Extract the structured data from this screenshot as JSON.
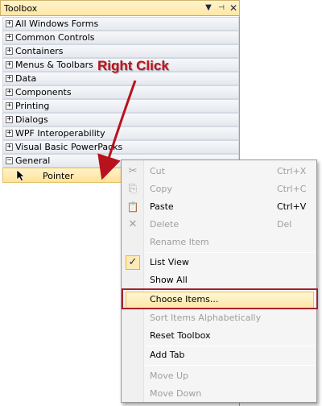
{
  "toolbox": {
    "title": "Toolbox",
    "dropdown_glyph": "▼",
    "pin_glyph": "⊣",
    "close_glyph": "✕",
    "tabs": [
      {
        "expander": "+",
        "label": "All Windows Forms"
      },
      {
        "expander": "+",
        "label": "Common Controls"
      },
      {
        "expander": "+",
        "label": "Containers"
      },
      {
        "expander": "+",
        "label": "Menus & Toolbars"
      },
      {
        "expander": "+",
        "label": "Data"
      },
      {
        "expander": "+",
        "label": "Components"
      },
      {
        "expander": "+",
        "label": "Printing"
      },
      {
        "expander": "+",
        "label": "Dialogs"
      },
      {
        "expander": "+",
        "label": "WPF Interoperability"
      },
      {
        "expander": "+",
        "label": "Visual Basic PowerPacks"
      },
      {
        "expander": "−",
        "label": "General"
      }
    ],
    "pointer_item": "Pointer"
  },
  "annotation": {
    "label": "Right Click",
    "color": "#c0101a"
  },
  "context_menu": {
    "items": [
      {
        "icon": "✂",
        "label": "Cut",
        "shortcut": "Ctrl+X"
      },
      {
        "icon": "⎘",
        "label": "Copy",
        "shortcut": "Ctrl+C"
      },
      {
        "icon": "📋",
        "label": "Paste",
        "shortcut": "Ctrl+V"
      },
      {
        "icon": "✕",
        "label": "Delete",
        "shortcut": "Del"
      },
      {
        "label": "Rename Item"
      },
      {
        "icon": "✓",
        "label": "List View"
      },
      {
        "label": "Show All"
      },
      {
        "label": "Choose Items..."
      },
      {
        "label": "Sort Items Alphabetically"
      },
      {
        "label": "Reset Toolbox"
      },
      {
        "label": "Add Tab"
      },
      {
        "label": "Move Up"
      },
      {
        "label": "Move Down"
      }
    ]
  },
  "colors": {
    "highlight_frame": "#a1242e",
    "disabled_text": "#9e9e9e",
    "selection_fill": "#fde7a6"
  }
}
